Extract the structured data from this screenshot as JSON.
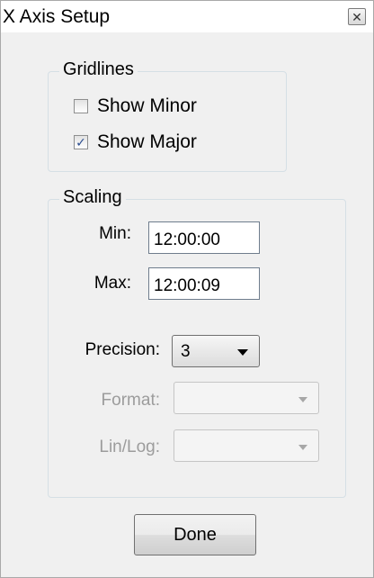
{
  "window": {
    "title": "X Axis Setup",
    "close_symbol": "✕"
  },
  "gridlines": {
    "title": "Gridlines",
    "show_minor": {
      "label": "Show Minor",
      "checked": false
    },
    "show_major": {
      "label": "Show Major",
      "checked": true,
      "check_symbol": "✓"
    }
  },
  "scaling": {
    "title": "Scaling",
    "min": {
      "label": "Min:",
      "value": "12:00:00"
    },
    "max": {
      "label": "Max:",
      "value": "12:00:09"
    },
    "precision": {
      "label": "Precision:",
      "value": "3"
    },
    "format": {
      "label": "Format:",
      "value": "",
      "enabled": false
    },
    "linlog": {
      "label": "Lin/Log:",
      "value": "",
      "enabled": false
    }
  },
  "done_button": {
    "label": "Done"
  }
}
